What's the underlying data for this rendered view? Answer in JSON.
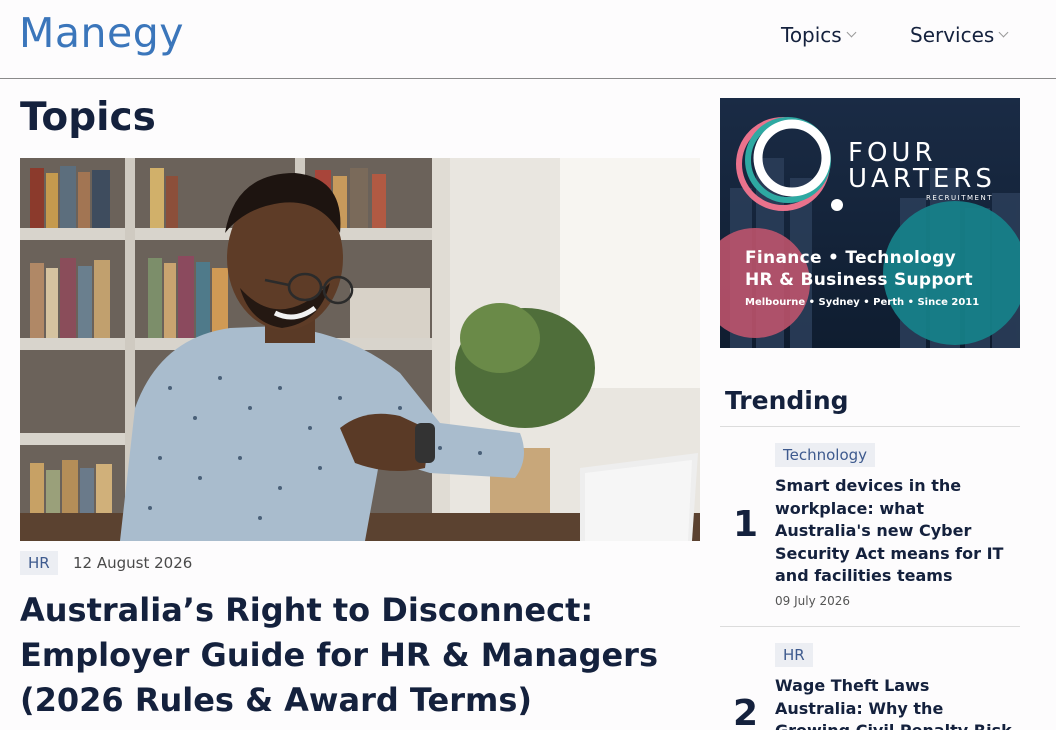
{
  "header": {
    "logo": "Manegy",
    "nav": [
      {
        "label": "Topics"
      },
      {
        "label": "Services"
      }
    ]
  },
  "main": {
    "page_title": "Topics",
    "featured": {
      "tag": "HR",
      "date": "12 August 2026",
      "title": "Australia’s Right to Disconnect: Employer Guide for HR & Managers (2026 Rules & Award Terms)"
    }
  },
  "ad": {
    "brand_line1": "FOUR",
    "brand_line2": "UARTERS",
    "brand_sub": "RECRUITMENT",
    "tagline1": "Finance • Technology",
    "tagline2": "HR & Business Support",
    "locations": "Melbourne • Sydney • Perth • Since 2011"
  },
  "trending": {
    "heading": "Trending",
    "items": [
      {
        "rank": "1",
        "tag": "Technology",
        "title": "Smart devices in the workplace: what Australia's new Cyber Security Act means for IT and facilities teams",
        "date": "09 July 2026"
      },
      {
        "rank": "2",
        "tag": "HR",
        "title": "Wage Theft Laws Australia: Why the Growing Civil Penalty Risk"
      }
    ]
  },
  "colors": {
    "brand": "#3b76bb",
    "navy": "#14213d",
    "tag_bg": "#eceef3",
    "ad_teal": "#16848c",
    "ad_pink": "#c7566f"
  }
}
